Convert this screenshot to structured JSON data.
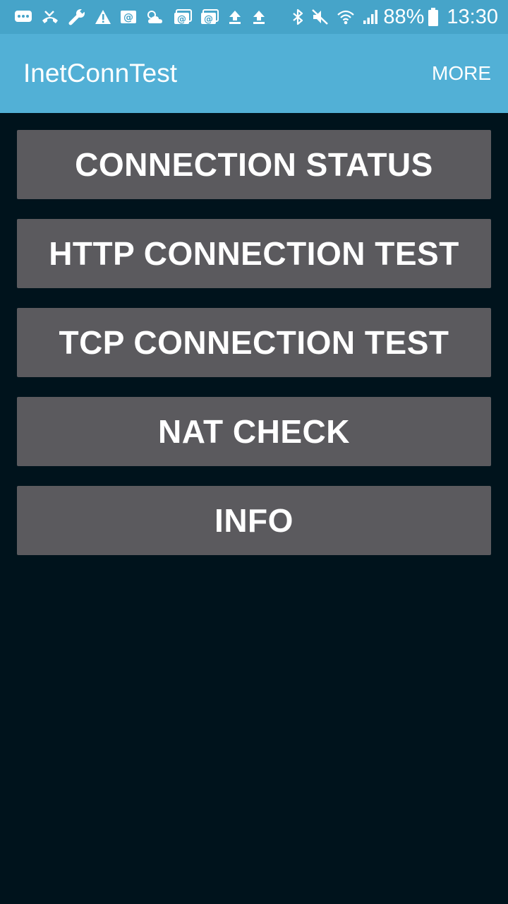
{
  "status_bar": {
    "left_icons": [
      "message-icon",
      "missed-call-icon",
      "wrench-icon",
      "warning-icon",
      "email-icon",
      "weather-icon",
      "email-icon",
      "email-icon",
      "upload-icon",
      "upload-icon"
    ],
    "right_icons": [
      "bluetooth-icon",
      "mute-icon",
      "wifi-icon",
      "signal-icon",
      "battery-icon"
    ],
    "battery": "88%",
    "time": "13:30"
  },
  "app_bar": {
    "title": "InetConnTest",
    "more_label": "MORE"
  },
  "menu": {
    "items": [
      {
        "label": "CONNECTION STATUS"
      },
      {
        "label": "HTTP CONNECTION TEST"
      },
      {
        "label": "TCP CONNECTION TEST"
      },
      {
        "label": "NAT CHECK"
      },
      {
        "label": "INFO"
      }
    ]
  },
  "colors": {
    "status_bar": "#46a4c9",
    "app_bar": "#52b0d6",
    "background": "#00131c",
    "button": "#5b5a5e",
    "text": "#ffffff"
  }
}
